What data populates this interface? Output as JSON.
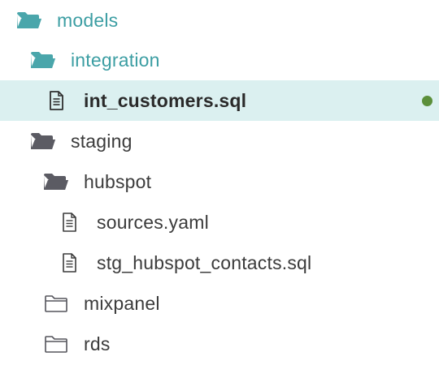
{
  "tree": {
    "models": {
      "label": "models",
      "icon": "folder-open-icon"
    },
    "integration": {
      "label": "integration",
      "icon": "folder-open-icon"
    },
    "int_customers": {
      "label": "int_customers.sql",
      "icon": "file-icon",
      "selected": true,
      "status": "modified-dot"
    },
    "staging": {
      "label": "staging",
      "icon": "folder-open-icon"
    },
    "hubspot": {
      "label": "hubspot",
      "icon": "folder-open-icon"
    },
    "sources": {
      "label": "sources.yaml",
      "icon": "file-icon"
    },
    "stg_hubspot_contacts": {
      "label": "stg_hubspot_contacts.sql",
      "icon": "file-icon"
    },
    "mixpanel": {
      "label": "mixpanel",
      "icon": "folder-closed-icon"
    },
    "rds": {
      "label": "rds",
      "icon": "folder-closed-icon"
    }
  },
  "colors": {
    "teal_folder": "#4aa6ab",
    "teal_text": "#3c9ea3",
    "dark_folder": "#5b5b63",
    "selected_bg": "#dbf0f0",
    "status_dot": "#5b8f3a"
  }
}
